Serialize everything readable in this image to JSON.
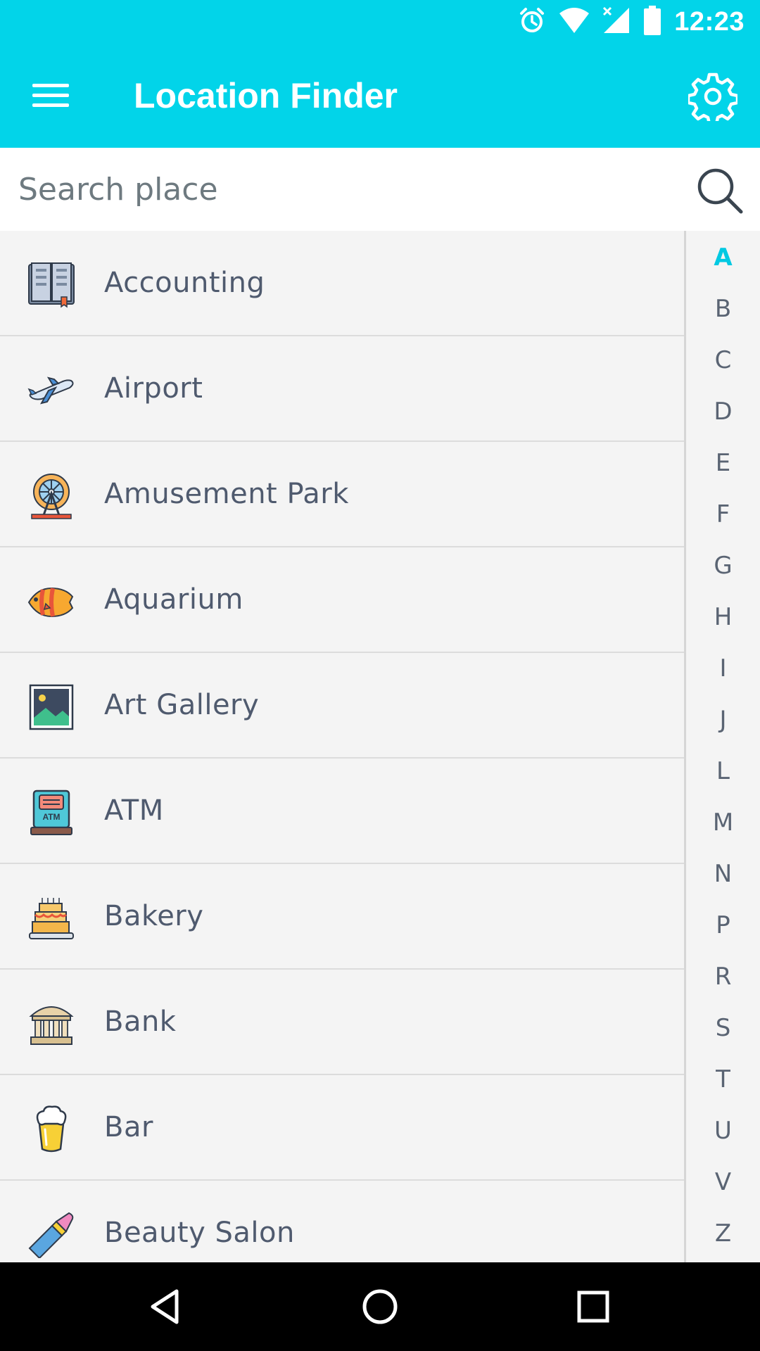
{
  "status_bar": {
    "time": "12:23",
    "icons": [
      "alarm-icon",
      "wifi-icon",
      "cell-signal-icon",
      "battery-icon"
    ]
  },
  "app_bar": {
    "title": "Location Finder",
    "menu_icon": "hamburger-menu-icon",
    "settings_icon": "gear-icon"
  },
  "search": {
    "placeholder": "Search place",
    "value": "",
    "icon": "search-icon"
  },
  "places": [
    {
      "label": "Accounting",
      "icon": "book-icon"
    },
    {
      "label": "Airport",
      "icon": "airplane-icon"
    },
    {
      "label": "Amusement Park",
      "icon": "ferris-wheel-icon"
    },
    {
      "label": "Aquarium",
      "icon": "fish-icon"
    },
    {
      "label": "Art Gallery",
      "icon": "picture-icon"
    },
    {
      "label": "ATM",
      "icon": "atm-icon"
    },
    {
      "label": "Bakery",
      "icon": "cake-icon"
    },
    {
      "label": "Bank",
      "icon": "bank-building-icon"
    },
    {
      "label": "Bar",
      "icon": "beer-glass-icon"
    },
    {
      "label": "Beauty Salon",
      "icon": "lipstick-icon"
    }
  ],
  "alphabet_index": {
    "letters": [
      "A",
      "B",
      "C",
      "D",
      "E",
      "F",
      "G",
      "H",
      "I",
      "J",
      "L",
      "M",
      "N",
      "P",
      "R",
      "S",
      "T",
      "U",
      "V",
      "Z"
    ],
    "active": "A",
    "active_color": "#02c9e2"
  },
  "nav_bar": {
    "icons": [
      "back-icon",
      "home-icon",
      "recents-icon"
    ]
  },
  "colors": {
    "primary": "#02d4e9",
    "text": "#4f5a6e",
    "background": "#f4f4f4"
  }
}
